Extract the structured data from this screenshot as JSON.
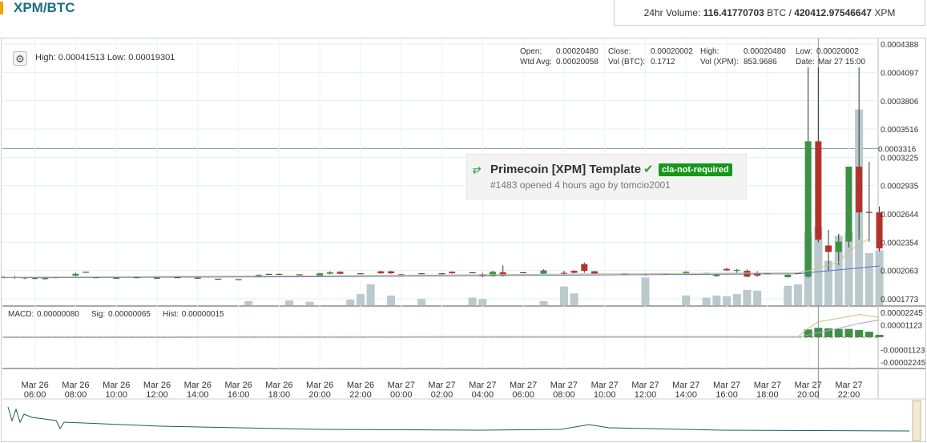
{
  "page": {
    "title": "XPM/BTC",
    "volume": {
      "prefix": "24hr Volume:",
      "btc_value": "116.41770703",
      "btc_unit": "BTC",
      "sep": "/",
      "xpm_value": "420412.97546647",
      "xpm_unit": "XPM"
    }
  },
  "header": {
    "high_low": "High: 0.00041513   Low: 0.00019301",
    "settings_icon": "gear-icon"
  },
  "ohlc": {
    "open_label": "Open:",
    "open": "0.00020480",
    "close_label": "Close:",
    "close": "0.00020002",
    "high_label": "High:",
    "high": "0.00020480",
    "low_label": "Low:",
    "low": "0.00020002",
    "wtd_label": "Wtd Avg:",
    "wtd": "0.00020058",
    "volbtc_label": "Vol (BTC):",
    "volbtc": "0.1712",
    "volxpm_label": "Vol (XPM):",
    "volxpm": "853.9686",
    "date_label": "Date:",
    "date": "Mar 27 15:00"
  },
  "macd_info": {
    "macd_label": "MACD:",
    "macd": "0.00000080",
    "sig_label": "Sig:",
    "sig": "0.00000065",
    "hist_label": "Hist:",
    "hist": "0.00000015"
  },
  "popup": {
    "icon": "pull-request-icon",
    "title": "Primecoin [XPM] Template",
    "badge": "cla-not-required",
    "meta": "#1483 opened 4 hours ago by tomcio2001"
  },
  "colors": {
    "up": "#3c9145",
    "down": "#b5322b",
    "volume": "#b9c9cc",
    "ma_short": "#c6c57a",
    "ma_long": "#5d6fcf",
    "accent": "#1b6e84"
  },
  "chart_data": {
    "type": "candlestick",
    "price_axis": {
      "ticks": [
        "0.0004388",
        "0.0004097",
        "0.0003806",
        "0.0003516",
        "0.0003225",
        "0.0002935",
        "0.0002644",
        "0.0002354",
        "0.0002063",
        "0.0001773"
      ],
      "crosshair_label": "0.0003316",
      "ylim": [
        0.0001773,
        0.0004388
      ]
    },
    "time_axis": {
      "ticks": [
        [
          "Mar 26",
          "06:00"
        ],
        [
          "Mar 26",
          "08:00"
        ],
        [
          "Mar 26",
          "10:00"
        ],
        [
          "Mar 26",
          "12:00"
        ],
        [
          "Mar 26",
          "14:00"
        ],
        [
          "Mar 26",
          "16:00"
        ],
        [
          "Mar 26",
          "18:00"
        ],
        [
          "Mar 26",
          "20:00"
        ],
        [
          "Mar 26",
          "22:00"
        ],
        [
          "Mar 27",
          "00:00"
        ],
        [
          "Mar 27",
          "02:00"
        ],
        [
          "Mar 27",
          "04:00"
        ],
        [
          "Mar 27",
          "06:00"
        ],
        [
          "Mar 27",
          "08:00"
        ],
        [
          "Mar 27",
          "10:00"
        ],
        [
          "Mar 27",
          "12:00"
        ],
        [
          "Mar 27",
          "14:00"
        ],
        [
          "Mar 27",
          "16:00"
        ],
        [
          "Mar 27",
          "18:00"
        ],
        [
          "Mar 27",
          "20:00"
        ],
        [
          "Mar 27",
          "22:00"
        ]
      ],
      "start_hour": 4.4,
      "end_hour": 47.4
    },
    "candles": [
      {
        "t": 4.5,
        "o": 0.0001995,
        "h": 0.0002,
        "l": 0.0001985,
        "c": 0.0001995
      },
      {
        "t": 5.0,
        "o": 0.0001995,
        "h": 0.000201,
        "l": 0.000198,
        "c": 0.0001988
      },
      {
        "t": 5.5,
        "o": 0.0001988,
        "h": 0.0002,
        "l": 0.0001975,
        "c": 0.0001985
      },
      {
        "t": 6.0,
        "o": 0.0001985,
        "h": 0.0001998,
        "l": 0.0001972,
        "c": 0.000198
      },
      {
        "t": 6.5,
        "o": 0.0001975,
        "h": 0.0001995,
        "l": 0.000197,
        "c": 0.000199
      },
      {
        "t": 7.0,
        "o": 0.000199,
        "h": 0.0001995,
        "l": 0.0001985,
        "c": 0.000199
      },
      {
        "t": 8.0,
        "o": 0.000201,
        "h": 0.000204,
        "l": 0.0002005,
        "c": 0.000203
      },
      {
        "t": 8.5,
        "o": 0.0002045,
        "h": 0.000205,
        "l": 0.000204,
        "c": 0.0002045
      },
      {
        "t": 9.0,
        "o": 0.000199,
        "h": 0.0001995,
        "l": 0.0001985,
        "c": 0.000199
      },
      {
        "t": 10.0,
        "o": 0.0001985,
        "h": 0.000199,
        "l": 0.000198,
        "c": 0.0001985
      },
      {
        "t": 11.0,
        "o": 0.000199,
        "h": 0.0001995,
        "l": 0.0001985,
        "c": 0.000199
      },
      {
        "t": 12.0,
        "o": 0.0001985,
        "h": 0.000199,
        "l": 0.000198,
        "c": 0.0001985
      },
      {
        "t": 13.0,
        "o": 0.000199,
        "h": 0.0001995,
        "l": 0.0001985,
        "c": 0.000199
      },
      {
        "t": 14.0,
        "o": 0.0001985,
        "h": 0.000199,
        "l": 0.000198,
        "c": 0.0001985
      },
      {
        "t": 15.0,
        "o": 0.0001975,
        "h": 0.000198,
        "l": 0.000197,
        "c": 0.0001975
      },
      {
        "t": 16.0,
        "o": 0.000197,
        "h": 0.0001975,
        "l": 0.0001965,
        "c": 0.000197
      },
      {
        "t": 17.0,
        "o": 0.0002,
        "h": 0.0002025,
        "l": 0.0001995,
        "c": 0.000202
      },
      {
        "t": 17.5,
        "o": 0.0002025,
        "h": 0.000203,
        "l": 0.000202,
        "c": 0.0002025
      },
      {
        "t": 18.0,
        "o": 0.0002025,
        "h": 0.000203,
        "l": 0.000202,
        "c": 0.0002025
      },
      {
        "t": 19.0,
        "o": 0.000202,
        "h": 0.0002025,
        "l": 0.0002015,
        "c": 0.000202
      },
      {
        "t": 20.0,
        "o": 0.0002,
        "h": 0.000204,
        "l": 0.0001995,
        "c": 0.0002035
      },
      {
        "t": 20.5,
        "o": 0.000203,
        "h": 0.0002055,
        "l": 0.0002025,
        "c": 0.0002045
      },
      {
        "t": 21.0,
        "o": 0.000205,
        "h": 0.0002055,
        "l": 0.0002025,
        "c": 0.000203
      },
      {
        "t": 22.0,
        "o": 0.000203,
        "h": 0.0002035,
        "l": 0.0002025,
        "c": 0.000203
      },
      {
        "t": 23.0,
        "o": 0.0002055,
        "h": 0.000206,
        "l": 0.000203,
        "c": 0.0002035
      },
      {
        "t": 23.5,
        "o": 0.0002055,
        "h": 0.000206,
        "l": 0.000203,
        "c": 0.0002035
      },
      {
        "t": 24.0,
        "o": 0.0002025,
        "h": 0.000203,
        "l": 0.0002005,
        "c": 0.000201
      },
      {
        "t": 25.0,
        "o": 0.000203,
        "h": 0.0002035,
        "l": 0.0002025,
        "c": 0.000203
      },
      {
        "t": 26.0,
        "o": 0.000203,
        "h": 0.0002035,
        "l": 0.0002025,
        "c": 0.000203
      },
      {
        "t": 26.5,
        "o": 0.000205,
        "h": 0.0002055,
        "l": 0.000203,
        "c": 0.0002035
      },
      {
        "t": 27.5,
        "o": 0.000204,
        "h": 0.0002045,
        "l": 0.0002035,
        "c": 0.000204
      },
      {
        "t": 28.0,
        "o": 0.0002025,
        "h": 0.000204,
        "l": 0.0001995,
        "c": 0.0002005
      },
      {
        "t": 28.5,
        "o": 0.0002005,
        "h": 0.000206,
        "l": 0.0002,
        "c": 0.000205
      },
      {
        "t": 29.0,
        "o": 0.0002045,
        "h": 0.0002115,
        "l": 0.0002,
        "c": 0.000201
      },
      {
        "t": 30.0,
        "o": 0.000204,
        "h": 0.0002045,
        "l": 0.0002035,
        "c": 0.000204
      },
      {
        "t": 31.0,
        "o": 0.000203,
        "h": 0.0002075,
        "l": 0.0002025,
        "c": 0.0002065
      },
      {
        "t": 32.0,
        "o": 0.000204,
        "h": 0.000206,
        "l": 0.000201,
        "c": 0.000203
      },
      {
        "t": 32.5,
        "o": 0.000206,
        "h": 0.0002065,
        "l": 0.0002035,
        "c": 0.000204
      },
      {
        "t": 33.0,
        "o": 0.000213,
        "h": 0.0002145,
        "l": 0.000204,
        "c": 0.000206
      },
      {
        "t": 33.5,
        "o": 0.0002055,
        "h": 0.000206,
        "l": 0.0002025,
        "c": 0.000203
      },
      {
        "t": 35.0,
        "o": 0.000203,
        "h": 0.0002035,
        "l": 0.0002025,
        "c": 0.000203
      },
      {
        "t": 36.0,
        "o": 0.000202,
        "h": 0.000203,
        "l": 0.0002015,
        "c": 0.0002025
      },
      {
        "t": 37.0,
        "o": 0.000203,
        "h": 0.0002035,
        "l": 0.0002025,
        "c": 0.000203
      },
      {
        "t": 38.0,
        "o": 0.000203,
        "h": 0.0002055,
        "l": 0.0002025,
        "c": 0.000205
      },
      {
        "t": 39.0,
        "o": 0.0002035,
        "h": 0.000204,
        "l": 0.000203,
        "c": 0.0002035
      },
      {
        "t": 39.5,
        "o": 0.0002005,
        "h": 0.0002025,
        "l": 0.0002,
        "c": 0.000202
      },
      {
        "t": 40.0,
        "o": 0.000208,
        "h": 0.000209,
        "l": 0.000206,
        "c": 0.0002065
      },
      {
        "t": 40.5,
        "o": 0.000206,
        "h": 0.000208,
        "l": 0.000204,
        "c": 0.000207
      },
      {
        "t": 41.0,
        "o": 0.000206,
        "h": 0.0002075,
        "l": 0.0001995,
        "c": 0.0002
      },
      {
        "t": 41.5,
        "o": 0.000204,
        "h": 0.0002055,
        "l": 0.0002,
        "c": 0.000201
      },
      {
        "t": 42.0,
        "o": 0.0002035,
        "h": 0.000204,
        "l": 0.000203,
        "c": 0.0002035
      },
      {
        "t": 43.0,
        "o": 0.0001995,
        "h": 0.0002025,
        "l": 0.000199,
        "c": 0.000202
      },
      {
        "t": 43.5,
        "o": 0.0002035,
        "h": 0.000204,
        "l": 0.000203,
        "c": 0.0002035
      },
      {
        "t": 44.0,
        "o": 0.0002,
        "h": 0.0004148,
        "l": 0.000199,
        "c": 0.000339
      },
      {
        "t": 44.5,
        "o": 0.000339,
        "h": 0.0004148,
        "l": 0.0002354,
        "c": 0.000238
      },
      {
        "t": 45.0,
        "o": 0.000232,
        "h": 0.000248,
        "l": 0.0002063,
        "c": 0.0002254
      },
      {
        "t": 45.5,
        "o": 0.0002254,
        "h": 0.000244,
        "l": 0.000212,
        "c": 0.000236
      },
      {
        "t": 46.0,
        "o": 0.000236,
        "h": 0.000298,
        "l": 0.00023,
        "c": 0.000313
      },
      {
        "t": 46.5,
        "o": 0.000313,
        "h": 0.0004148,
        "l": 0.000238,
        "c": 0.000266
      },
      {
        "t": 47.0,
        "o": 0.000266,
        "h": 0.000318,
        "l": 0.000236,
        "c": 0.000266
      },
      {
        "t": 47.5,
        "o": 0.000266,
        "h": 0.000272,
        "l": 0.000226,
        "c": 0.000229
      }
    ],
    "volume_bars": [
      {
        "t": 16.5,
        "v": 0.06
      },
      {
        "t": 18.5,
        "v": 0.07
      },
      {
        "t": 19.5,
        "v": 0.05
      },
      {
        "t": 21.5,
        "v": 0.08
      },
      {
        "t": 22.0,
        "v": 0.16
      },
      {
        "t": 22.5,
        "v": 0.3
      },
      {
        "t": 23.5,
        "v": 0.14
      },
      {
        "t": 25.0,
        "v": 0.09
      },
      {
        "t": 27.5,
        "v": 0.11
      },
      {
        "t": 28.0,
        "v": 0.09
      },
      {
        "t": 31.0,
        "v": 0.06
      },
      {
        "t": 32.0,
        "v": 0.27
      },
      {
        "t": 32.5,
        "v": 0.17
      },
      {
        "t": 36.0,
        "v": 0.4
      },
      {
        "t": 38.0,
        "v": 0.14
      },
      {
        "t": 39.0,
        "v": 0.11
      },
      {
        "t": 39.5,
        "v": 0.14
      },
      {
        "t": 40.0,
        "v": 0.13
      },
      {
        "t": 40.5,
        "v": 0.16
      },
      {
        "t": 41.0,
        "v": 0.22
      },
      {
        "t": 41.5,
        "v": 0.21
      },
      {
        "t": 43.0,
        "v": 0.28
      },
      {
        "t": 43.5,
        "v": 0.3
      },
      {
        "t": 44.0,
        "v": 1.05
      },
      {
        "t": 44.5,
        "v": 1.13
      },
      {
        "t": 45.0,
        "v": 0.64
      },
      {
        "t": 45.5,
        "v": 1.0
      },
      {
        "t": 46.0,
        "v": 1.05
      },
      {
        "t": 46.5,
        "v": 2.82
      },
      {
        "t": 47.0,
        "v": 0.75
      },
      {
        "t": 47.5,
        "v": 0.79
      }
    ],
    "volume_max": 3.0,
    "ma_short": [
      {
        "t": 4.5,
        "v": 0.0001995
      },
      {
        "t": 20,
        "v": 0.000201
      },
      {
        "t": 35,
        "v": 0.000203
      },
      {
        "t": 43.5,
        "v": 0.000204
      },
      {
        "t": 44.0,
        "v": 0.000206
      },
      {
        "t": 44.5,
        "v": 0.000209
      },
      {
        "t": 45.0,
        "v": 0.000212
      },
      {
        "t": 45.5,
        "v": 0.000215
      },
      {
        "t": 46.0,
        "v": 0.000226
      },
      {
        "t": 46.5,
        "v": 0.000233
      },
      {
        "t": 47.0,
        "v": 0.000239
      }
    ],
    "ma_long": [
      {
        "t": 4.5,
        "v": 0.000199
      },
      {
        "t": 20,
        "v": 0.0002
      },
      {
        "t": 35,
        "v": 0.000202
      },
      {
        "t": 43.5,
        "v": 0.000203
      },
      {
        "t": 44.5,
        "v": 0.000205
      },
      {
        "t": 45.5,
        "v": 0.000207
      },
      {
        "t": 46.5,
        "v": 0.000209
      },
      {
        "t": 47.5,
        "v": 0.000211
      }
    ],
    "macd_axis": {
      "ticks": [
        "0.00002245",
        "0.00001123",
        "-0.00001123",
        "-0.00002245"
      ],
      "ylim": [
        -2.45e-05,
        2.45e-05
      ]
    },
    "macd_hist": [
      {
        "t": 44.0,
        "v": 7e-06
      },
      {
        "t": 44.5,
        "v": 8.5e-06
      },
      {
        "t": 45.0,
        "v": 8e-06
      },
      {
        "t": 45.5,
        "v": 7.5e-06
      },
      {
        "t": 46.0,
        "v": 7.5e-06
      },
      {
        "t": 46.5,
        "v": 6.5e-06
      },
      {
        "t": 47.0,
        "v": 5e-06
      },
      {
        "t": 47.5,
        "v": 2.2e-06
      }
    ],
    "macd_line": [
      {
        "t": 4.5,
        "v": 5e-07
      },
      {
        "t": 43.5,
        "v": 8e-07
      },
      {
        "t": 44.0,
        "v": 8e-06
      },
      {
        "t": 44.5,
        "v": 1.4e-05
      },
      {
        "t": 45.5,
        "v": 1.7e-05
      },
      {
        "t": 46.5,
        "v": 2.05e-05
      },
      {
        "t": 47.5,
        "v": 1.8e-05
      }
    ],
    "macd_signal": [
      {
        "t": 4.5,
        "v": -3e-07
      },
      {
        "t": 43.5,
        "v": 1e-07
      },
      {
        "t": 44.5,
        "v": 4e-06
      },
      {
        "t": 45.5,
        "v": 8e-06
      },
      {
        "t": 46.5,
        "v": 1.25e-05
      },
      {
        "t": 47.5,
        "v": 1.55e-05
      }
    ]
  }
}
